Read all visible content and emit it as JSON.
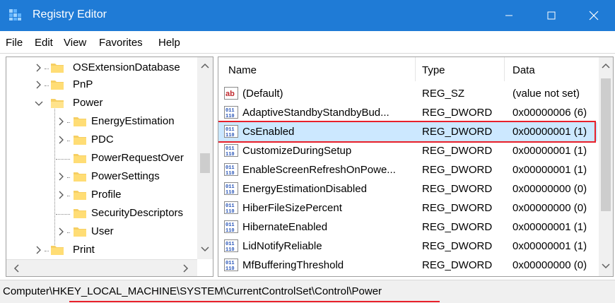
{
  "window": {
    "title": "Registry Editor",
    "accent_color": "#1f7bd6",
    "highlight_color": "#e8202a"
  },
  "menu": {
    "items": [
      "File",
      "Edit",
      "View",
      "Favorites",
      "Help"
    ]
  },
  "tree": {
    "items": [
      {
        "label": "OSExtensionDatabase",
        "expander": "chevron-right",
        "level": 1
      },
      {
        "label": "PnP",
        "expander": "chevron-right",
        "level": 1
      },
      {
        "label": "Power",
        "expander": "chevron-down",
        "level": 1,
        "selected": true
      },
      {
        "label": "EnergyEstimation",
        "expander": "chevron-right",
        "level": 2
      },
      {
        "label": "PDC",
        "expander": "chevron-right",
        "level": 2
      },
      {
        "label": "PowerRequestOver",
        "expander": "none",
        "level": 2
      },
      {
        "label": "PowerSettings",
        "expander": "chevron-right",
        "level": 2
      },
      {
        "label": "Profile",
        "expander": "chevron-right",
        "level": 2
      },
      {
        "label": "SecurityDescriptors",
        "expander": "none",
        "level": 2
      },
      {
        "label": "User",
        "expander": "chevron-right",
        "level": 2
      },
      {
        "label": "Print",
        "expander": "chevron-right",
        "level": 1
      }
    ]
  },
  "values": {
    "columns": {
      "name": "Name",
      "type": "Type",
      "data": "Data"
    },
    "rows": [
      {
        "icon": "string-value-icon",
        "name": "(Default)",
        "type": "REG_SZ",
        "data": "(value not set)"
      },
      {
        "icon": "binary-value-icon",
        "name": "AdaptiveStandbyStandbyBud...",
        "type": "REG_DWORD",
        "data": "0x00000006 (6)"
      },
      {
        "icon": "binary-value-icon",
        "name": "CsEnabled",
        "type": "REG_DWORD",
        "data": "0x00000001 (1)",
        "selected": true
      },
      {
        "icon": "binary-value-icon",
        "name": "CustomizeDuringSetup",
        "type": "REG_DWORD",
        "data": "0x00000001 (1)"
      },
      {
        "icon": "binary-value-icon",
        "name": "EnableScreenRefreshOnPowe...",
        "type": "REG_DWORD",
        "data": "0x00000001 (1)"
      },
      {
        "icon": "binary-value-icon",
        "name": "EnergyEstimationDisabled",
        "type": "REG_DWORD",
        "data": "0x00000000 (0)"
      },
      {
        "icon": "binary-value-icon",
        "name": "HiberFileSizePercent",
        "type": "REG_DWORD",
        "data": "0x00000000 (0)"
      },
      {
        "icon": "binary-value-icon",
        "name": "HibernateEnabled",
        "type": "REG_DWORD",
        "data": "0x00000001 (1)"
      },
      {
        "icon": "binary-value-icon",
        "name": "LidNotifyReliable",
        "type": "REG_DWORD",
        "data": "0x00000001 (1)"
      },
      {
        "icon": "binary-value-icon",
        "name": "MfBufferingThreshold",
        "type": "REG_DWORD",
        "data": "0x00000000 (0)"
      }
    ]
  },
  "status": {
    "path_prefix": "Computer\\",
    "path_rest": "HKEY_LOCAL_MACHINE\\SYSTEM\\CurrentControlSet\\Control\\Power"
  }
}
